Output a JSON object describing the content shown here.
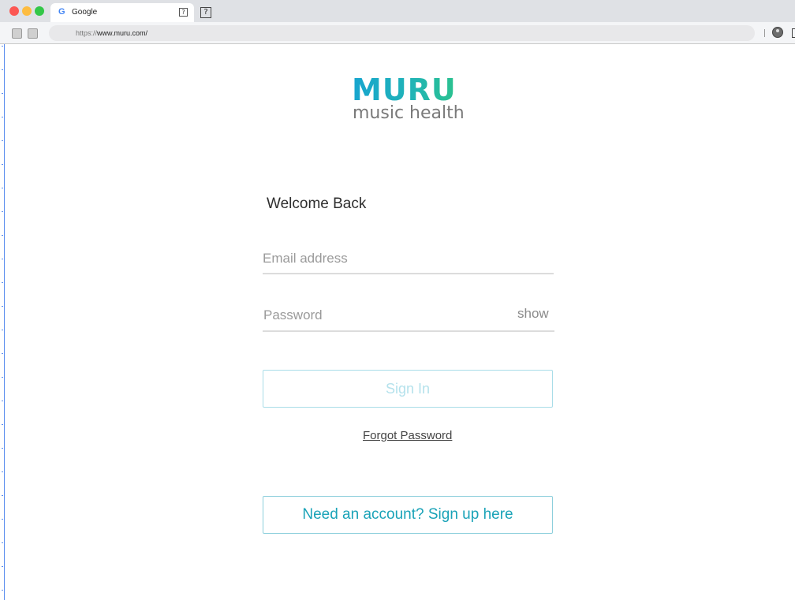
{
  "browser": {
    "tab": {
      "favicon": "G",
      "title": "Google",
      "icon": "question-square-icon"
    },
    "new_tab_icon": "?",
    "tab_q": "?",
    "url_scheme": "https://",
    "url_host": "www.muru.com/"
  },
  "logo": {
    "wordmark": "MURU",
    "tagline": "music health",
    "gradient_colors": [
      "#17a5cf",
      "#2bc28e"
    ]
  },
  "login": {
    "heading": "Welcome Back",
    "email_placeholder": "Email address",
    "password_placeholder": "Password",
    "show_label": "show",
    "signin_label": "Sign In",
    "forgot_label": "Forgot Password",
    "signup_label": "Need an account? Sign up here"
  },
  "colors": {
    "accent": "#1aa3b8",
    "disabled_text": "#b5e2ec"
  }
}
